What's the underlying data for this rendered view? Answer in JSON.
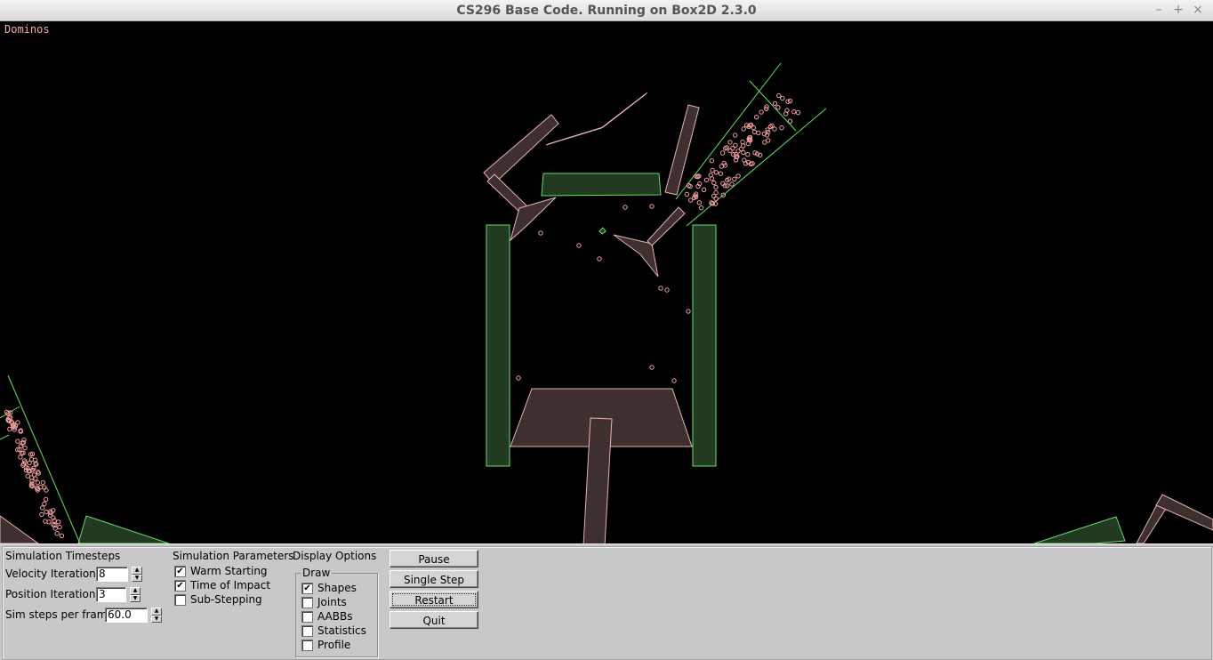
{
  "window": {
    "title": "CS296 Base Code. Running on Box2D 2.3.0",
    "controls": [
      "–",
      "+",
      "×"
    ]
  },
  "scene": {
    "label": "Dominos",
    "colors": {
      "background": "#000000",
      "static_fill": "#223a22",
      "static_stroke": "#66dd66",
      "dynamic_fill": "#3f3030",
      "dynamic_stroke": "#e8b0b0",
      "particle": "#f0a0a0"
    }
  },
  "panel": {
    "timesteps": {
      "title": "Simulation Timesteps",
      "velocity_label": "Velocity Iterations",
      "velocity_value": "8",
      "position_label": "Position Iterations",
      "position_value": "3",
      "steps_label": "Sim steps per frame",
      "steps_value": "60.0"
    },
    "parameters": {
      "title": "Simulation Parameters",
      "warm_starting": {
        "label": "Warm Starting",
        "checked": true
      },
      "time_of_impact": {
        "label": "Time of Impact",
        "checked": true
      },
      "sub_stepping": {
        "label": "Sub-Stepping",
        "checked": false
      }
    },
    "display": {
      "title": "Display Options",
      "draw_legend": "Draw",
      "shapes": {
        "label": "Shapes",
        "checked": true
      },
      "joints": {
        "label": "Joints",
        "checked": false
      },
      "aabbs": {
        "label": "AABBs",
        "checked": false
      },
      "statistics": {
        "label": "Statistics",
        "checked": false
      },
      "profile": {
        "label": "Profile",
        "checked": false
      }
    },
    "buttons": {
      "pause": "Pause",
      "single_step": "Single Step",
      "restart": "Restart",
      "quit": "Quit"
    }
  }
}
